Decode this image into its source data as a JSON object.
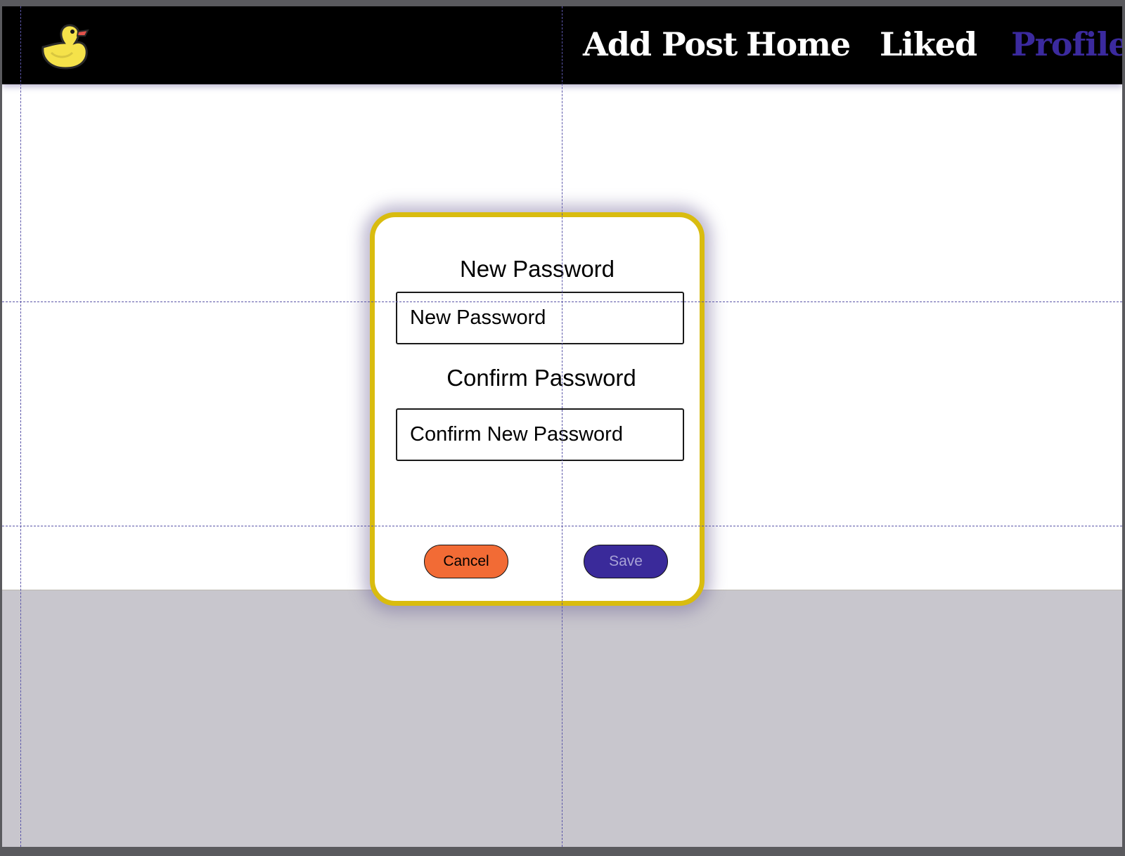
{
  "navbar": {
    "logo": "rubber-duck-icon",
    "links": [
      {
        "label": "Add Post"
      },
      {
        "label": "Home"
      },
      {
        "label": "Liked"
      },
      {
        "label": "Profile",
        "active": true
      }
    ]
  },
  "dialog": {
    "new_password": {
      "label": "New Password",
      "placeholder": "New Password"
    },
    "confirm_password": {
      "label": "Confirm Password",
      "placeholder": "Confirm New Password"
    },
    "cancel_label": "Cancel",
    "save_label": "Save"
  },
  "colors": {
    "navbar_bg": "#000000",
    "active_link": "#3b2a9e",
    "dialog_border": "#d9bc0f",
    "cancel_button": "#f26b35",
    "save_button": "#3a2a9a",
    "backdrop": "#c8c6cd"
  }
}
